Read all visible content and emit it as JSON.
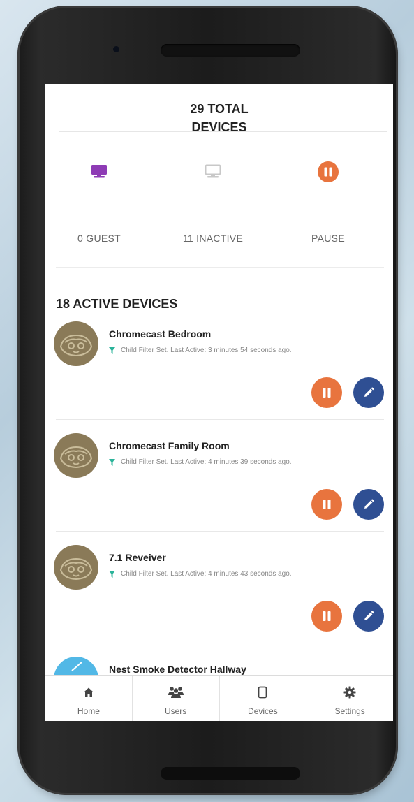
{
  "header": {
    "title_line1": "29 TOTAL",
    "title_line2": "DEVICES"
  },
  "stats": [
    {
      "label": "0 GUEST",
      "icon": "monitor-icon",
      "color": "#8e3bb5"
    },
    {
      "label": "11 INACTIVE",
      "icon": "monitor-icon",
      "color": "#c8c8c8"
    },
    {
      "label": "PAUSE",
      "icon": "pause-icon",
      "color": "#e8743e"
    }
  ],
  "section": {
    "title": "18 ACTIVE DEVICES"
  },
  "devices": [
    {
      "name": "Chromecast Bedroom",
      "status": "Child Filter Set. Last Active: 3 minutes 54 seconds ago."
    },
    {
      "name": "Chromecast Family Room",
      "status": "Child Filter Set. Last Active: 4 minutes 39 seconds ago."
    },
    {
      "name": "7.1 Reveiver",
      "status": "Child Filter Set. Last Active: 4 minutes 43 seconds ago."
    },
    {
      "name": "Nest Smoke Detector Hallway",
      "status": ""
    }
  ],
  "nav": {
    "items": [
      {
        "label": "Home",
        "icon": "home-icon"
      },
      {
        "label": "Users",
        "icon": "users-icon"
      },
      {
        "label": "Devices",
        "icon": "device-icon"
      },
      {
        "label": "Settings",
        "icon": "gear-icon"
      }
    ]
  },
  "colors": {
    "pause": "#e8743e",
    "edit": "#2f4f93",
    "filter": "#2bb39a",
    "guest": "#8e3bb5",
    "inactive": "#c8c8c8"
  }
}
